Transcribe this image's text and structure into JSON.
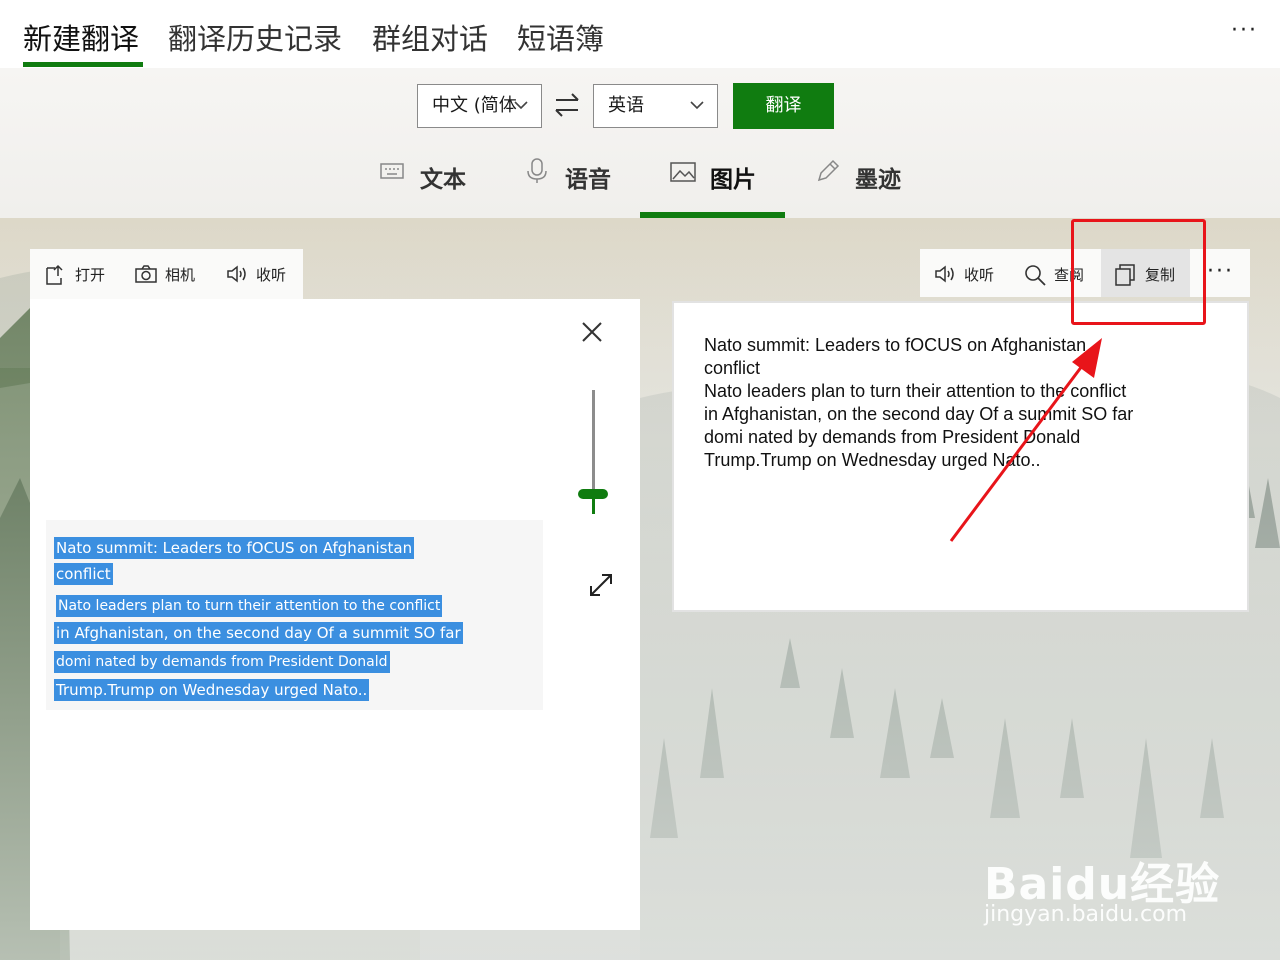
{
  "top_nav": {
    "tabs": [
      "新建翻译",
      "翻译历史记录",
      "群组对话",
      "短语簿"
    ],
    "active_tab": "新建翻译",
    "more_label": "···"
  },
  "language_bar": {
    "source_lang": "中文 (简体",
    "target_lang": "英语",
    "translate_button": "翻译"
  },
  "modes": {
    "items": [
      "文本",
      "语音",
      "图片",
      "墨迹"
    ],
    "active": "图片"
  },
  "left_toolbar": {
    "open": "打开",
    "camera": "相机",
    "listen": "收听"
  },
  "image_lines": [
    "Nato summit: Leaders to fOCUS on Afghanistan",
    "conflict",
    "Nato leaders plan to turn their attention to the conflict",
    "in Afghanistan, on the second day Of a summit SO far",
    "domi nated by demands from President Donald",
    "Trump.Trump on Wednesday urged Nato.."
  ],
  "right_toolbar": {
    "listen": "收听",
    "lookup": "查阅",
    "copy": "复制",
    "more": "···"
  },
  "result_lines": [
    "Nato summit: Leaders to fOCUS on Afghanistan",
    "conflict",
    "Nato leaders plan to turn their attention to the conflict",
    "in Afghanistan, on the second day Of a summit SO far",
    "domi nated by demands from President Donald",
    "Trump.Trump on Wednesday urged Nato.."
  ],
  "colors": {
    "accent": "#107c10",
    "highlight": "#3b8fe0",
    "annotation": "#e8141a"
  },
  "watermark": {
    "logo": "Baidu经验",
    "url": "jingyan.baidu.com"
  }
}
